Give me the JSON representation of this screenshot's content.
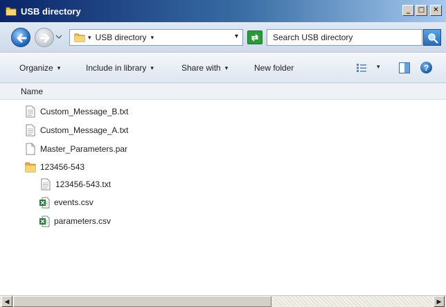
{
  "window": {
    "title": "USB directory",
    "minimize_glyph": "_",
    "maximize_glyph": "□",
    "close_glyph": "✕"
  },
  "address": {
    "breadcrumb_sep": "▾",
    "crumb": "USB directory",
    "crumb_caret": "▾",
    "dropdown_glyph": "▾"
  },
  "search": {
    "placeholder": "Search USB directory"
  },
  "toolbar": {
    "organize": "Organize",
    "include_in_library": "Include in library",
    "share_with": "Share with",
    "new_folder": "New folder",
    "caret": "▾",
    "help_glyph": "?"
  },
  "columns": {
    "name": "Name"
  },
  "files": [
    {
      "name": "Custom_Message_B.txt",
      "icon": "text-file-icon",
      "indent": 0
    },
    {
      "name": "Custom_Message_A.txt",
      "icon": "text-file-icon",
      "indent": 0
    },
    {
      "name": "Master_Parameters.par",
      "icon": "blank-file-icon",
      "indent": 0
    },
    {
      "name": "123456-543",
      "icon": "folder-icon",
      "indent": 0
    },
    {
      "name": "123456-543.txt",
      "icon": "text-file-icon",
      "indent": 1
    },
    {
      "name": "events.csv",
      "icon": "excel-csv-icon",
      "indent": 1
    },
    {
      "name": "parameters.csv",
      "icon": "excel-csv-icon",
      "indent": 1
    }
  ],
  "scrollbar": {
    "left_glyph": "◀",
    "right_glyph": "▶"
  },
  "colors": {
    "titlebar_start": "#0a246a",
    "titlebar_end": "#a6caf0",
    "folder": "#e8b33a",
    "excel_green": "#1f7a35"
  }
}
